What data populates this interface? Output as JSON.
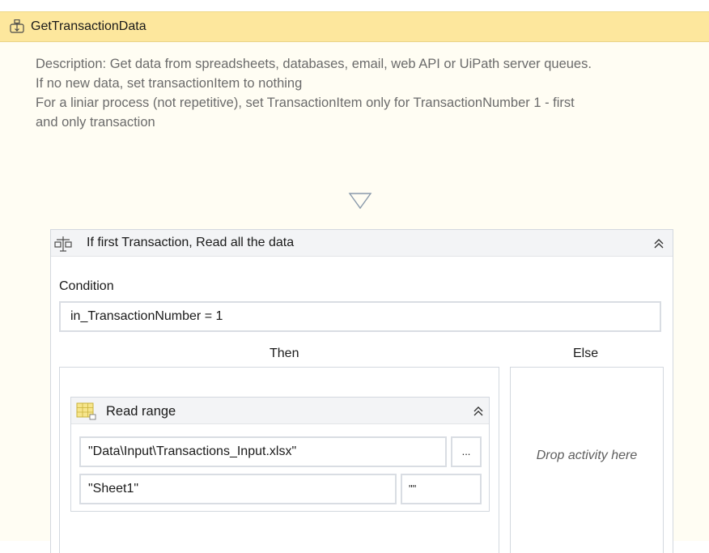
{
  "sequence": {
    "title": "GetTransactionData",
    "icon": "sequence-icon",
    "description": "Description: Get data from spreadsheets, databases, email, web API or UiPath server queues.\nIf no new data, set transactionItem to nothing\nFor a liniar process (not repetitive), set TransactionItem only for TransactionNumber 1 - first\nand only transaction"
  },
  "if_activity": {
    "title": "If first Transaction, Read all the data",
    "icon": "if-icon",
    "condition_label": "Condition",
    "condition_value": "in_TransactionNumber = 1",
    "then_label": "Then",
    "else_label": "Else",
    "else_placeholder": "Drop activity here"
  },
  "read_range": {
    "title": "Read range",
    "icon": "excel-range-icon",
    "workbook_path": "\"Data\\Input\\Transactions_Input.xlsx\"",
    "browse_label": "...",
    "sheet_name": "\"Sheet1\"",
    "range": "\"\""
  },
  "colors": {
    "header_bg": "#fde79d",
    "sequence_bg": "#fffdf3",
    "activity_header_bg": "#f3f4f6",
    "border": "#d3d8df"
  }
}
